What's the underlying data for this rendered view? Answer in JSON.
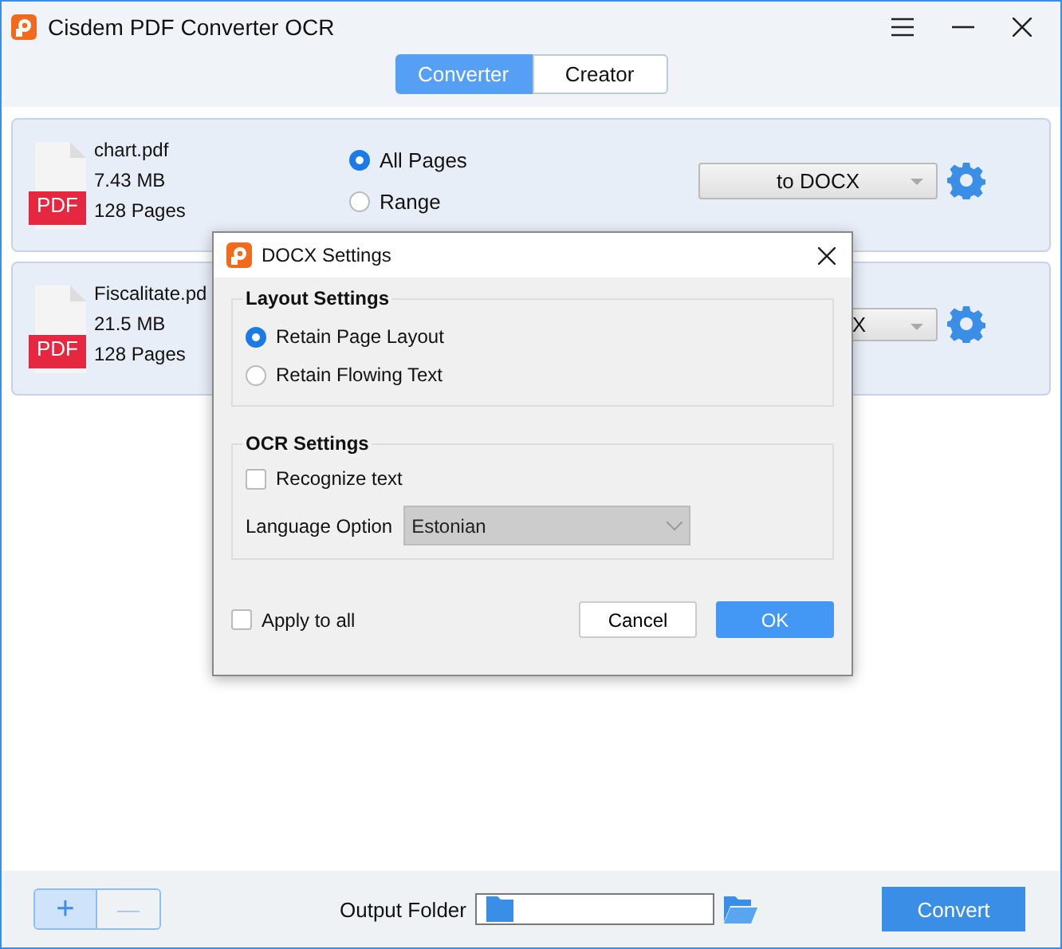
{
  "window": {
    "title": "Cisdem PDF Converter OCR"
  },
  "tabs": [
    {
      "label": "Converter",
      "selected": true
    },
    {
      "label": "Creator",
      "selected": false
    }
  ],
  "files": [
    {
      "badge": "PDF",
      "name": "chart.pdf",
      "size": "7.43 MB",
      "pages": "128 Pages",
      "options": [
        {
          "label": "All Pages",
          "selected": true
        },
        {
          "label": "Range",
          "selected": false
        }
      ],
      "format": "to DOCX"
    },
    {
      "badge": "PDF",
      "name": "Fiscalitate.pd",
      "size": "21.5 MB",
      "pages": "128 Pages",
      "format": "X"
    }
  ],
  "dialog": {
    "title": "DOCX Settings",
    "layout": {
      "legend": "Layout Settings",
      "options": [
        {
          "label": "Retain Page Layout",
          "selected": true
        },
        {
          "label": "Retain Flowing Text",
          "selected": false
        }
      ]
    },
    "ocr": {
      "legend": "OCR Settings",
      "recognize": {
        "label": "Recognize text",
        "checked": false
      },
      "language_label": "Language Option",
      "language": "Estonian",
      "language_disabled": true
    },
    "apply_all": {
      "label": "Apply to all",
      "checked": false
    },
    "buttons": [
      "Cancel",
      "OK"
    ]
  },
  "bottom": {
    "add": "+",
    "remove": "—",
    "output_label": "Output Folder",
    "convert": "Convert"
  }
}
